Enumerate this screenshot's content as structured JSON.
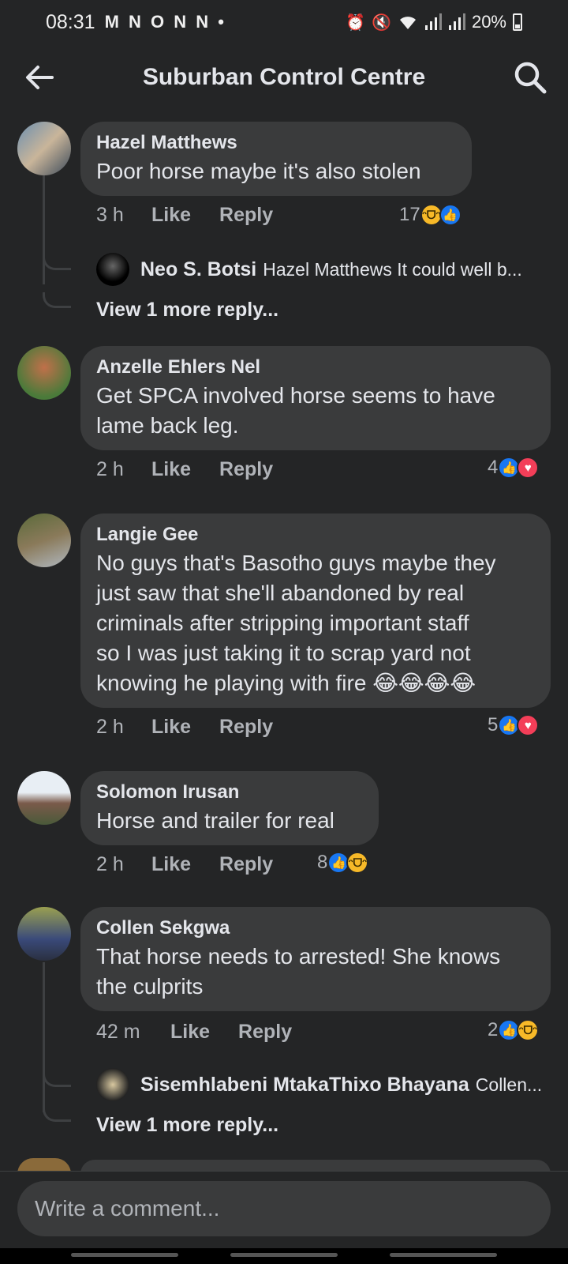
{
  "status_bar": {
    "time": "08:31",
    "notifications": "M N O N N •",
    "icons": [
      "alarm-icon",
      "mute-icon",
      "wifi-icon",
      "signal-icon",
      "signal-icon"
    ],
    "battery": "20%"
  },
  "header": {
    "title": "Suburban Control Centre",
    "back_icon": "arrow-left-icon",
    "search_icon": "search-icon"
  },
  "comments": [
    {
      "name": "Hazel Matthews",
      "text": "Poor horse maybe it's also stolen",
      "time": "3 h",
      "like": "Like",
      "reply": "Reply",
      "reaction_count": "17",
      "reactions": [
        "haha",
        "like"
      ],
      "replies_preview": {
        "name": "Neo S. Botsi",
        "text": "Hazel Matthews It could well b...",
        "more": "View 1 more reply..."
      }
    },
    {
      "name": "Anzelle Ehlers Nel",
      "text_lines": [
        "Get SPCA involved horse seems to have",
        "lame back leg."
      ],
      "time": "2 h",
      "like": "Like",
      "reply": "Reply",
      "reaction_count": "4",
      "reactions": [
        "like",
        "love"
      ]
    },
    {
      "name": "Langie Gee",
      "text_lines": [
        "No guys that's Basotho guys maybe they",
        "just saw that she'll abandoned by real",
        "criminals after stripping important staff",
        "so I was just taking it to scrap yard not",
        "knowing he playing with fire 😂😂😂😂"
      ],
      "time": "2 h",
      "like": "Like",
      "reply": "Reply",
      "reaction_count": "5",
      "reactions": [
        "like",
        "love"
      ]
    },
    {
      "name": "Solomon Irusan",
      "text": "Horse and trailer for real",
      "time": "2 h",
      "like": "Like",
      "reply": "Reply",
      "reaction_count": "8",
      "reactions": [
        "like",
        "haha"
      ]
    },
    {
      "name": "Collen Sekgwa",
      "text_lines": [
        "That horse needs to arrested! She knows",
        "the culprits"
      ],
      "time": "42 m",
      "like": "Like",
      "reply": "Reply",
      "reaction_count": "2",
      "reactions": [
        "like",
        "haha"
      ],
      "replies_preview": {
        "name": "Sisemhlabeni MtakaThixo Bhayana",
        "text": "Collen...",
        "more": "View 1 more reply..."
      }
    }
  ],
  "composer": {
    "placeholder": "Write a comment..."
  },
  "colors": {
    "background": "#242526",
    "bubble": "#3a3b3c",
    "like_blue": "#1877f2",
    "love_red": "#f33e58",
    "haha_yellow": "#f7b928"
  }
}
